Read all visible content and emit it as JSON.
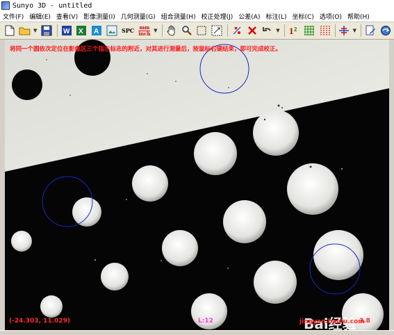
{
  "window": {
    "title": "Sunyo 3D - untitled"
  },
  "menu": [
    "文件(F)",
    "编辑(E)",
    "查看(V)",
    "影像测量(I)",
    "几何测量(G)",
    "组合测量(H)",
    "校正处理(J)",
    "公差(A)",
    "标注(L)",
    "坐标(C)",
    "选项(O)",
    "帮助(H)"
  ],
  "toolbar": {
    "spc_label": "SPC",
    "unit_label_top": "mm",
    "unit_label_bottom": "inch"
  },
  "viewport": {
    "instruction": "将同一个圆依次定位在影像区三个指示标志的附近，对其进行测量后，按鼠标右键结束，即可完成校正。",
    "coordinates": "(-24.303, 11.029)",
    "l_value": "L:12",
    "zoom": "3.8",
    "watermark": "Bai经验",
    "site": "jingyan.baidu.com"
  }
}
